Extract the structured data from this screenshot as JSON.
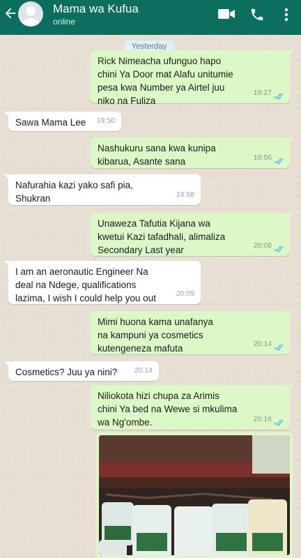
{
  "header": {
    "contact_name": "Mama wa Kufua",
    "status": "online",
    "icons": [
      "back-arrow-icon",
      "avatar-placeholder",
      "video-call-icon",
      "phone-icon",
      "more-vert-icon"
    ],
    "color": "#0b6e5e"
  },
  "date_divider": "Yesterday",
  "messages": [
    {
      "dir": "out",
      "text": "Rick Nimeacha ufunguo hapo\nchini Ya Door mat Alafu unitumie\npesa kwa Number ya Airtel juu\nniko na Fuliza",
      "time": "19:27"
    },
    {
      "dir": "in",
      "text": "Sawa Mama Lee",
      "time": "19:50"
    },
    {
      "dir": "out",
      "text": "Nashukuru sana kwa kunipa\nkibarua, Asante sana",
      "time": "19:56"
    },
    {
      "dir": "in",
      "text": "Nafurahia kazi yako safi pia,\nShukran",
      "time": "19:58"
    },
    {
      "dir": "out",
      "text": "Unaweza Tafutia Kijana wa\nkwetui Kazi tafadhali, alimaliza\nSecondary Last year",
      "time": "20:08"
    },
    {
      "dir": "in",
      "text": "I am an aeronautic Engineer Na\ndeal na Ndege, qualifications\nlazima, I wish I could help you out",
      "time": "20:09"
    },
    {
      "dir": "out",
      "text": "Mimi huona kama unafanya\nna kampuni ya cosmetics\nkutengeneza mafuta",
      "time": "20:14"
    },
    {
      "dir": "in",
      "text": "Cosmetics? Juu ya nini?",
      "time": "20:14"
    },
    {
      "dir": "out",
      "text": "Niliokota hizi chupa za Arimis\nchini Ya bed na Wewe si mkulima\nwa Ng'ombe.",
      "time": "20:16"
    }
  ],
  "photo": {
    "description_icon": "image-attachment"
  },
  "colors": {
    "outgoing": "#dcf8c6",
    "incoming": "#ffffff",
    "read_ticks": "#4fb6ec"
  }
}
